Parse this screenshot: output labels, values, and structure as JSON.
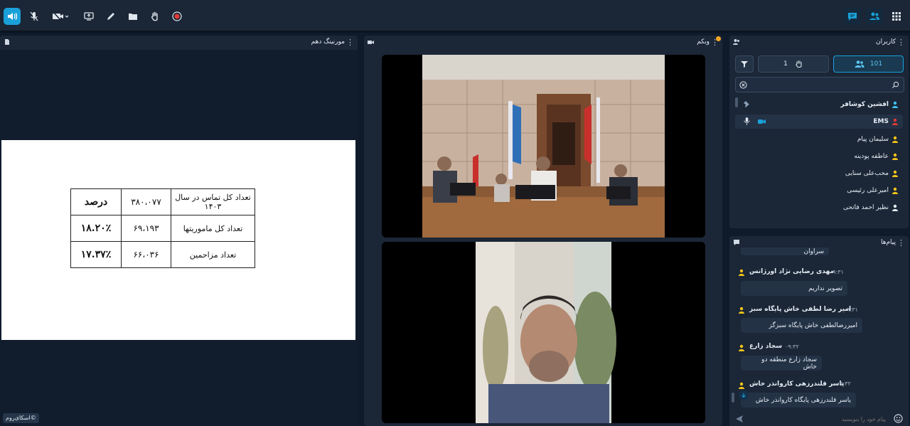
{
  "toolbar": {
    "left_buttons": [
      "speaker-icon",
      "mic-off-icon",
      "camera-off-icon",
      "share-screen-icon",
      "pen-icon",
      "folder-icon",
      "raise-hand-icon",
      "record-icon"
    ],
    "right_buttons": [
      "chat-icon",
      "users-icon",
      "grid-icon"
    ]
  },
  "presentation": {
    "title": "مورنینگ دهم",
    "table": [
      [
        "تعداد کل تماس در سال ۱۴۰۳",
        "۳۸۰،۰۷۷",
        "درصد"
      ],
      [
        "تعداد کل ماموریتها",
        "۶۹،۱۹۳",
        "۱۸.۲۰٪"
      ],
      [
        "تعداد مزاحمین",
        "۶۶،۰۳۶",
        "۱۷.۳۷٪"
      ]
    ],
    "brand": "©اسکای‌روم"
  },
  "webcam": {
    "title": "وبکم"
  },
  "users": {
    "title": "کاربران",
    "count": "101",
    "hands": "1",
    "search_placeholder": "",
    "list": [
      {
        "name": "افشین کوشافر",
        "status": "blue"
      },
      {
        "name": "EMS",
        "status": "red"
      },
      {
        "name": "سلیمان پیام",
        "status": "yellow"
      },
      {
        "name": "عاطفه پودینه",
        "status": "yellow"
      },
      {
        "name": "محب‌علی سنایی",
        "status": "yellow"
      },
      {
        "name": "امیرعلی رئیسی",
        "status": "yellow"
      },
      {
        "name": "نظیر احمد فاتحی",
        "status": "white"
      }
    ]
  },
  "messages": {
    "title": "پیام‌ها",
    "partial": "احمد تقی زهی منطقه یک سراوان",
    "items": [
      {
        "name": "مهدی رضایی نژاد اورژانس",
        "time": "۰۹:۳۱",
        "text": "تصویر نداریم"
      },
      {
        "name": "امیر رضا لطفی خاش پایگاه سبز",
        "time": "۰۹:۳۱",
        "text": "امیررضالطفی خاش پایگاه سبزگز"
      },
      {
        "name": "سجاد زارع",
        "time": "۰۹:۳۲",
        "text": "سجاد زارع منطقه دو خاش"
      },
      {
        "name": "یاسر قلندرزهی کاروانذر خاش",
        "time": "۰۹:۳۲",
        "text": "یاسر قلندرزهی پایگاه کاروانذر خاش"
      }
    ],
    "input_placeholder": "پیام خود را بنویسید"
  },
  "colors": {
    "accent": "#1aa0d8",
    "panel": "#1b2636",
    "background": "#0f1a2a",
    "record": "#e53935"
  }
}
